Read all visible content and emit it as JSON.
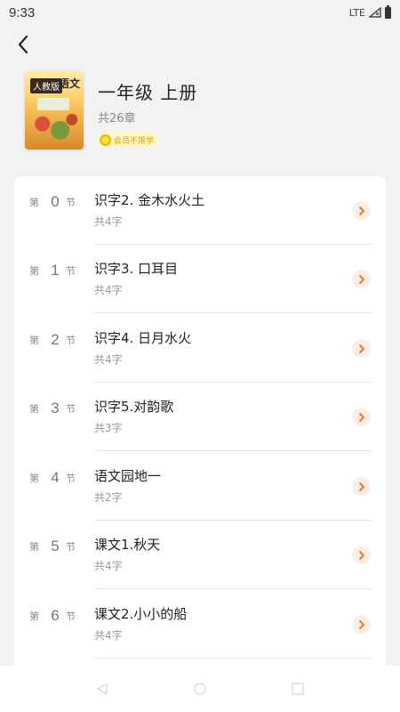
{
  "status": {
    "time": "9:33",
    "network": "LTE"
  },
  "book": {
    "cover_edition": "人教版",
    "cover_title": "语文",
    "title": "一年级 上册",
    "chapters": "共26章",
    "vip_badge": "会员不限学"
  },
  "lessons": [
    {
      "pre": "第",
      "num": "0",
      "post": "节",
      "title": "识字2. 金木水火土",
      "count": "共4字"
    },
    {
      "pre": "第",
      "num": "1",
      "post": "节",
      "title": "识字3. 口耳目",
      "count": "共4字"
    },
    {
      "pre": "第",
      "num": "2",
      "post": "节",
      "title": "识字4. 日月水火",
      "count": "共4字"
    },
    {
      "pre": "第",
      "num": "3",
      "post": "节",
      "title": "识字5.对韵歌",
      "count": "共3字"
    },
    {
      "pre": "第",
      "num": "4",
      "post": "节",
      "title": "语文园地一",
      "count": "共2字"
    },
    {
      "pre": "第",
      "num": "5",
      "post": "节",
      "title": "课文1.秋天",
      "count": "共4字"
    },
    {
      "pre": "第",
      "num": "6",
      "post": "节",
      "title": "课文2.小小的船",
      "count": "共4字"
    }
  ],
  "colors": {
    "accent": "#f07a2a",
    "chevron_bg": "#fbeee6",
    "badge_text": "#d9a000"
  },
  "icons": {
    "back": "back-arrow-icon",
    "row_chevron": "chevron-right-icon",
    "nav_back": "nav-back-icon",
    "nav_home": "nav-home-icon",
    "nav_recents": "nav-recents-icon"
  }
}
